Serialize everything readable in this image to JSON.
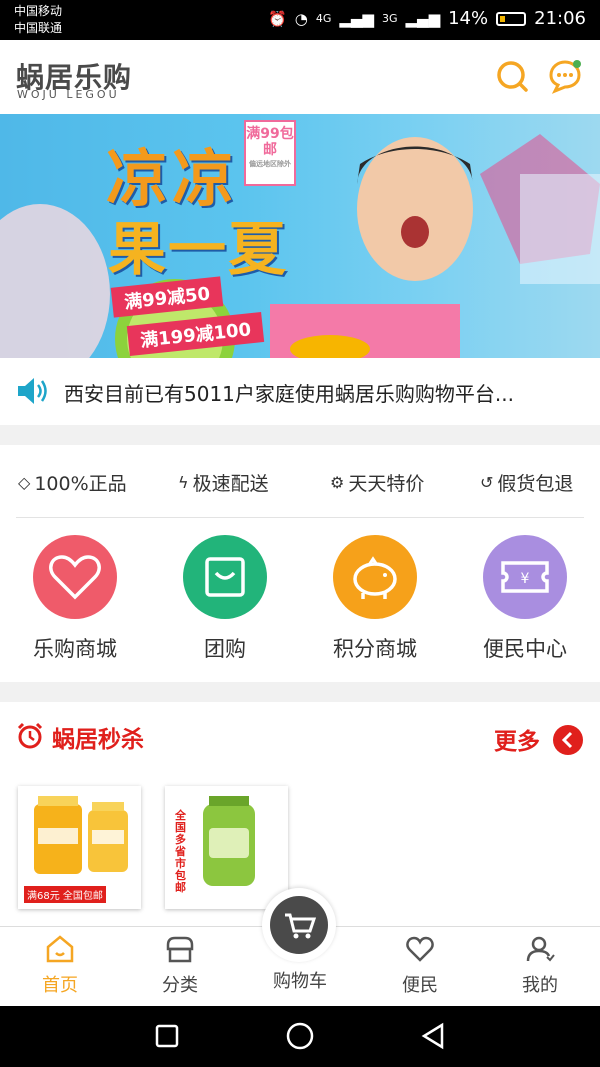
{
  "status": {
    "carrier1": "中国移动",
    "carrier2": "中国联通",
    "net1": "4G",
    "net2": "3G",
    "battery": "14%",
    "time": "21:06"
  },
  "header": {
    "logo_cn": "蜗居乐购",
    "logo_en": "WOJU LEGOU"
  },
  "banner": {
    "headline1": "凉凉",
    "headline2": "果一夏",
    "badge": "满99包邮",
    "badge_sub": "偏远地区除外",
    "promo1": "满99减50",
    "promo2": "满199减100"
  },
  "notice": {
    "text": "西安目前已有5011户家庭使用蜗居乐购购物平台..."
  },
  "features": [
    "100%正品",
    "极速配送",
    "天天特价",
    "假货包退"
  ],
  "categories": [
    {
      "label": "乐购商城",
      "color": "#ef5b6a"
    },
    {
      "label": "团购",
      "color": "#22b47a"
    },
    {
      "label": "积分商城",
      "color": "#f6a11a"
    },
    {
      "label": "便民中心",
      "color": "#a98ee0"
    }
  ],
  "flash": {
    "title": "蜗居秒杀",
    "more": "更多"
  },
  "products": [
    {
      "tag": "满68元 全国包邮"
    },
    {
      "tag": "全国多省市包邮"
    }
  ],
  "tabs": [
    "首页",
    "分类",
    "购物车",
    "便民",
    "我的"
  ],
  "colors": {
    "accent": "#f5a623",
    "red": "#e0201c"
  }
}
